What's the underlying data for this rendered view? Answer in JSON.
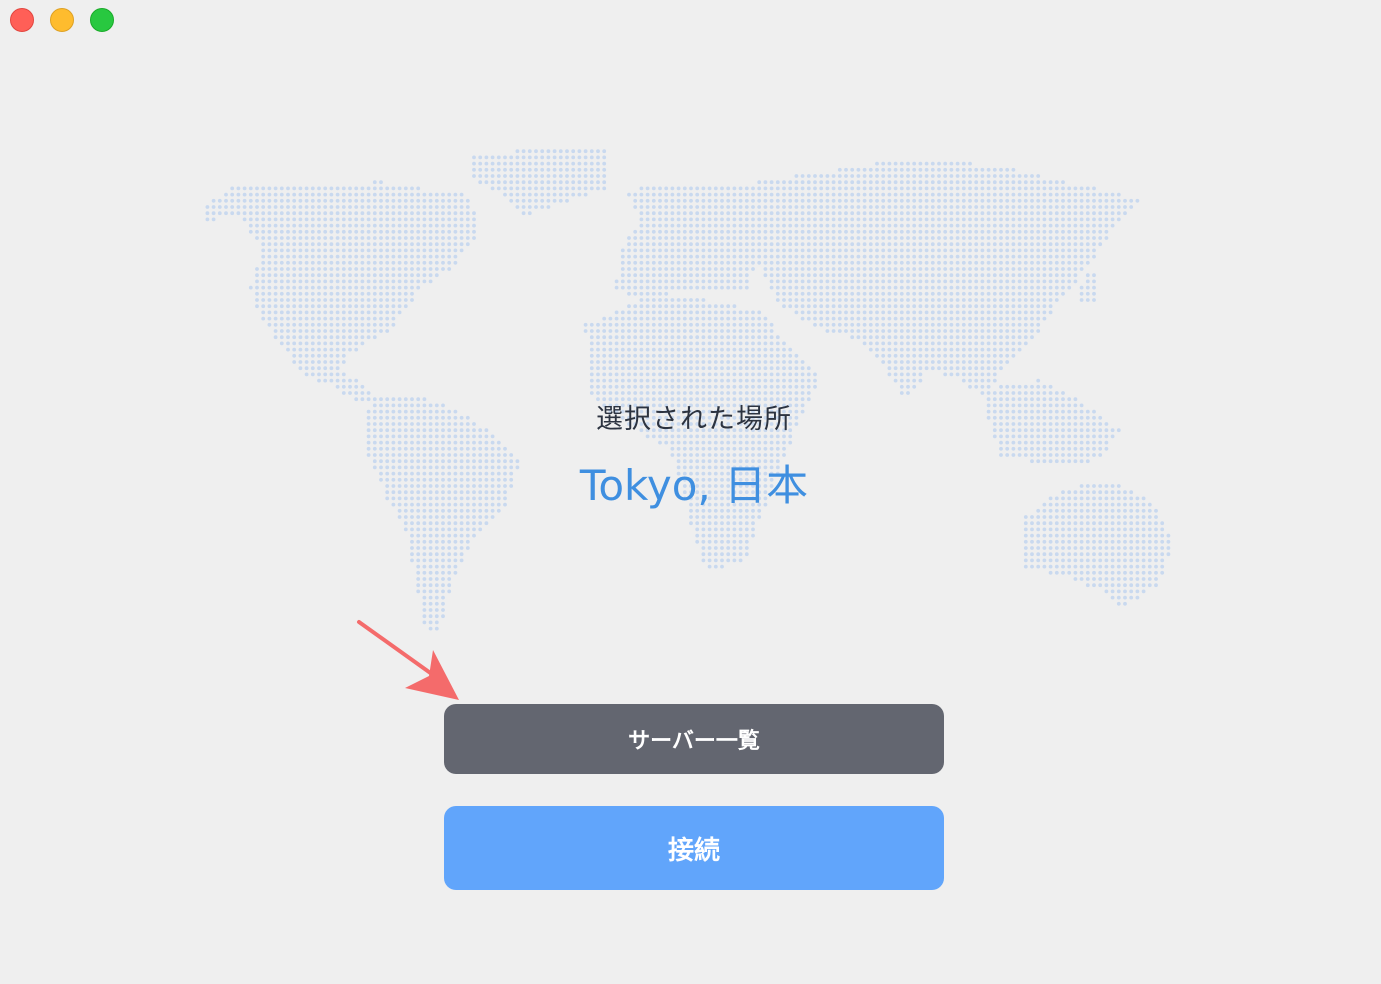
{
  "window": {
    "controls": [
      "close",
      "minimize",
      "zoom"
    ]
  },
  "location": {
    "label": "選択された場所",
    "value": "Tokyo, 日本"
  },
  "buttons": {
    "server_list": "サーバー一覧",
    "connect": "接続"
  },
  "colors": {
    "background": "#efefef",
    "map_dot": "#c9d9ef",
    "accent": "#3f8fe0",
    "primary_button": "#61a5fb",
    "secondary_button": "#636670",
    "annotation_arrow": "#f46b6b"
  },
  "icons": {
    "map": "world-map-dotted",
    "annotation": "arrow-annotation"
  }
}
